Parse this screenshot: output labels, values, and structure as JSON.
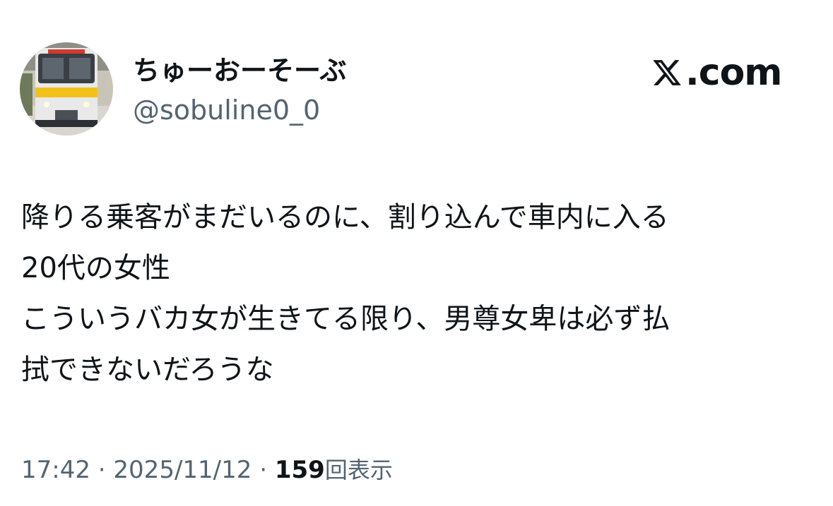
{
  "user": {
    "display_name": "ちゅーおーそーぶ",
    "handle": "@sobuline0_0",
    "avatar_icon": "train-avatar-icon"
  },
  "brand": {
    "text": ".com",
    "icon": "x-logo-icon"
  },
  "tweet": {
    "lines": [
      "降りる乗客がまだいるのに、割り込んで車内に入る",
      "20代の女性",
      "こういうバカ女が生きてる限り、男尊女卑は必ず払",
      "拭できないだろうな"
    ]
  },
  "meta": {
    "time": "17:42",
    "separator": " · ",
    "date": "2025/11/12",
    "views_count": "159",
    "views_label": "回表示"
  },
  "colors": {
    "text_primary": "#0f1419",
    "text_secondary": "#536471",
    "background": "#ffffff"
  }
}
